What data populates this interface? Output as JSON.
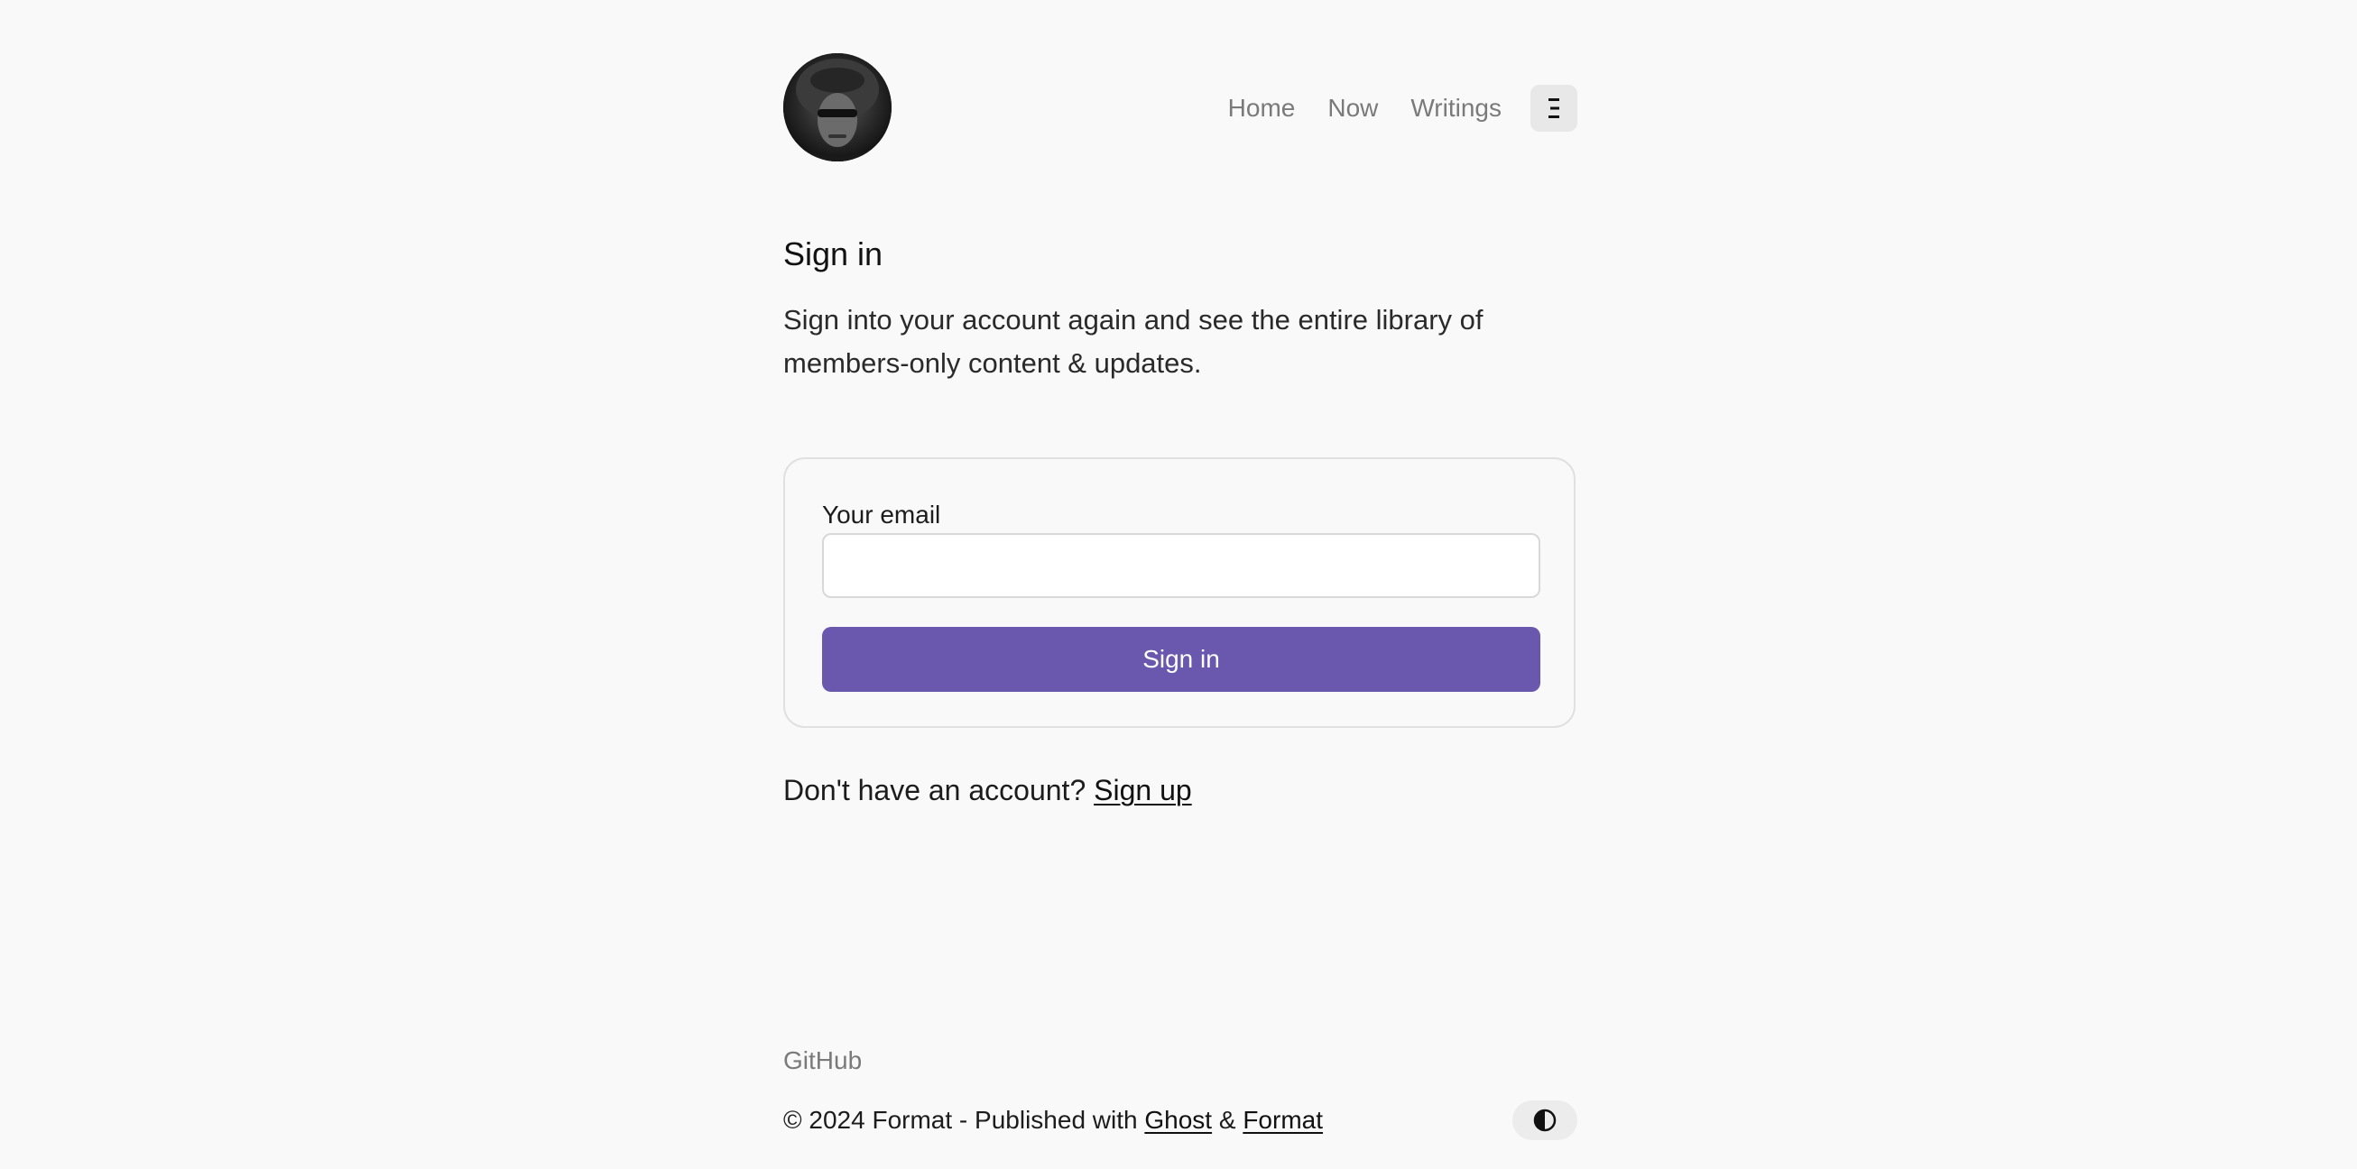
{
  "header": {
    "avatar_alt": "",
    "nav": [
      {
        "label": "Home"
      },
      {
        "label": "Now"
      },
      {
        "label": "Writings"
      }
    ],
    "menu_icon": "menu-icon"
  },
  "main": {
    "title": "Sign in",
    "subtitle": "Sign into your account again and see the entire library of members-only content & updates.",
    "form": {
      "email_label": "Your email",
      "email_value": "",
      "email_placeholder": "",
      "submit_label": "Sign in"
    },
    "account_prompt": "Don't have an account?",
    "signup_label": "Sign up"
  },
  "footer": {
    "github_label": "GitHub",
    "copyright_prefix": "© 2024 Format - Published with",
    "ghost_label": "Ghost",
    "amp": "&",
    "format_label": "Format",
    "theme_icon": "contrast-icon"
  },
  "colors": {
    "background": "#f9f9f9",
    "accent": "#6a57ae",
    "muted_text": "#7a7a7a"
  }
}
